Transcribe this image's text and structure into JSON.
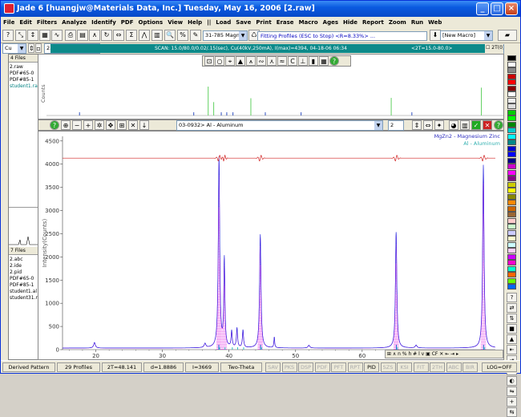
{
  "window": {
    "title": "Jade 6 [huangjw@Materials Data, Inc.] Tuesday, May 16, 2006 [2.raw]"
  },
  "menu": [
    "File",
    "Edit",
    "Filters",
    "Analyze",
    "Identify",
    "PDF",
    "Options",
    "View",
    "Help",
    "||",
    "Load",
    "Save",
    "Print",
    "Erase",
    "Macro",
    "Ages",
    "Hide",
    "Report",
    "Zoom",
    "Run",
    "Web"
  ],
  "toolbar": {
    "pdf_select": "31-785 Magne",
    "fit_status": "Fitting Profiles (ESC to Stop) <R=8.33%> ...",
    "macro_select": "[New Macro]"
  },
  "toolbar2": {
    "target_select": "Cu",
    "file_select": "2.raw",
    "scan_info": "SCAN: 15.0/80.0/0.02/.15(sec), Cu(40kV,250mA), I(max)=4394, 04-18-06 06:34",
    "range_info": "<2T=15.0-80.0>",
    "theta_label": "2T(0)",
    "theta_value": "00"
  },
  "left_panel": {
    "files_header": "4 Files",
    "files": [
      "2.raw",
      "PDF#65-0",
      "PDF#85-1",
      "student1.ra"
    ],
    "files2_header": "7 Files",
    "files2": [
      "2.abc",
      "2.ide",
      "2.pid",
      "PDF#65-0",
      "PDF#85-1",
      "student1.al",
      "student31.ra"
    ]
  },
  "upper_plot": {
    "ylabel": "Counts"
  },
  "overlay_bar": {
    "phase_select": "03-0932> Al - Aluminum",
    "page_value": "2"
  },
  "legend": {
    "entry1": "MgZn2 - Magnesium Zinc",
    "entry2": "Al - Aluminum"
  },
  "status": {
    "pattern": "Derived Pattern",
    "profiles": "29 Profiles",
    "two_theta": "2T=48.141",
    "d_value": "d=1.8886",
    "intensity": "I=3669",
    "axis_mode": "Two-Theta",
    "flags": [
      "SAV",
      "PKS",
      "DSP",
      "PDF",
      "PFT",
      "RPT",
      "PID",
      "SZS",
      "KSI",
      "FIT",
      "2TH",
      "ABC",
      "BIR"
    ],
    "log": "LOG=OFF"
  },
  "chart_data": {
    "type": "line",
    "ylabel": "Intensity(Counts)",
    "xlim": [
      15,
      80
    ],
    "ylim": [
      0,
      4600
    ],
    "x_ticks": [
      20,
      30,
      40,
      50,
      60,
      70
    ],
    "y_ticks": [
      0,
      500,
      1000,
      1500,
      2000,
      2500,
      3000,
      3500,
      4000,
      4500
    ],
    "colors": {
      "profile": "#3030e0",
      "fit": "#e020e0",
      "difference": "#d02020",
      "phase1": "#1070d0",
      "phase2": "#30c0c0"
    },
    "peaks": [
      {
        "x": 38.5,
        "y": 4100,
        "w": 0.25
      },
      {
        "x": 39.3,
        "y": 1900,
        "w": 0.2
      },
      {
        "x": 40.4,
        "y": 350,
        "w": 0.2
      },
      {
        "x": 41.2,
        "y": 420,
        "w": 0.2
      },
      {
        "x": 42.1,
        "y": 380,
        "w": 0.2
      },
      {
        "x": 44.7,
        "y": 2450,
        "w": 0.25
      },
      {
        "x": 46.8,
        "y": 230,
        "w": 0.15
      },
      {
        "x": 65.1,
        "y": 2500,
        "w": 0.25
      },
      {
        "x": 78.2,
        "y": 3950,
        "w": 0.25
      },
      {
        "x": 19.8,
        "y": 120,
        "w": 0.3
      },
      {
        "x": 36.4,
        "y": 90,
        "w": 0.3
      },
      {
        "x": 52.0,
        "y": 60,
        "w": 0.3
      },
      {
        "x": 68.1,
        "y": 60,
        "w": 0.3
      }
    ],
    "background": 35,
    "difference_offset": 4130,
    "phase_sticks_1": [
      38.47,
      44.74,
      65.13,
      78.23
    ],
    "phase_sticks_2": [
      38.6,
      39.4,
      40.5,
      41.3,
      42.2,
      44.9,
      65.3,
      78.4
    ]
  }
}
